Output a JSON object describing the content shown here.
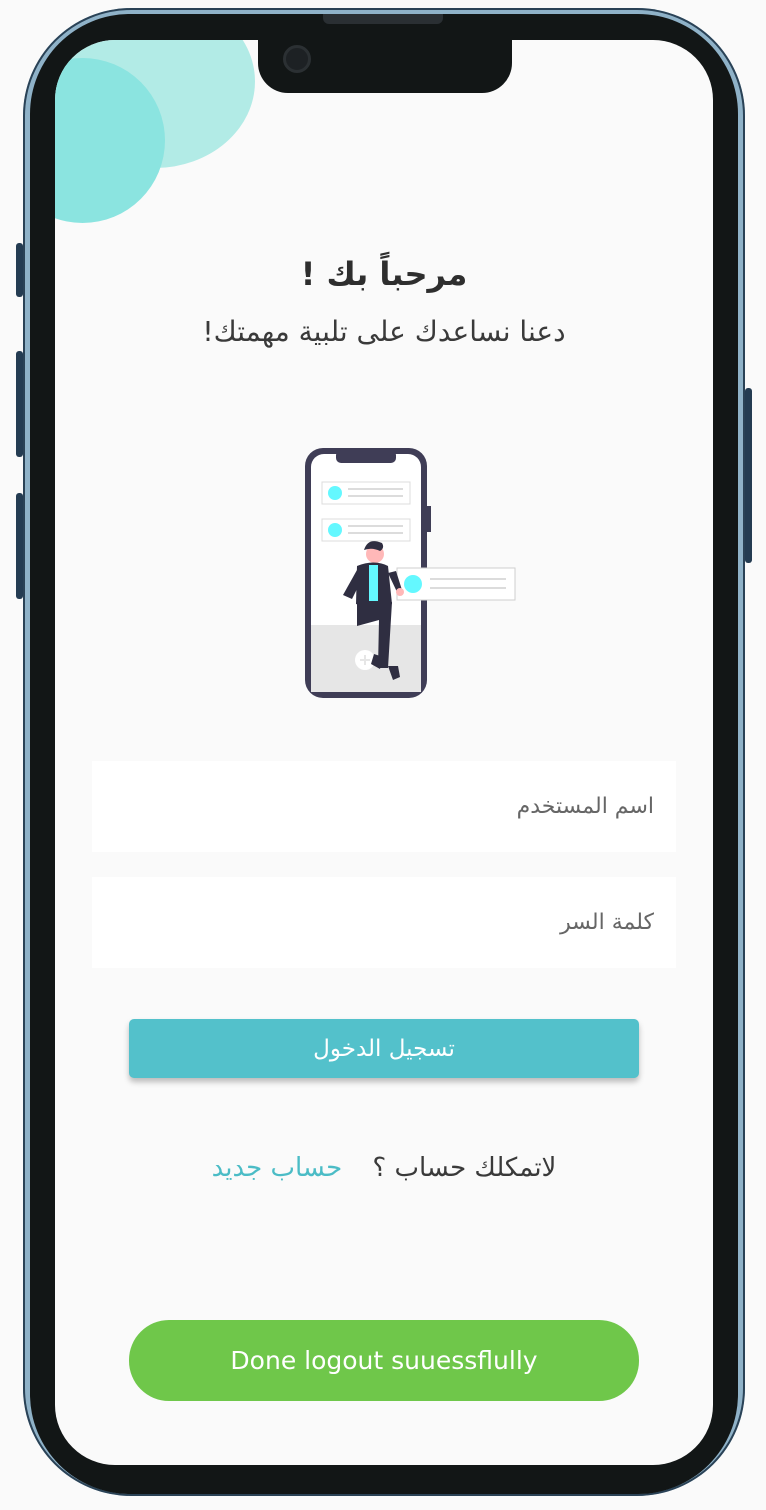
{
  "header": {
    "title": "مرحباً بك !",
    "subtitle": "دعنا نساعدك على تلبية مهمتك!"
  },
  "form": {
    "username_placeholder": "اسم المستخدم",
    "password_placeholder": "كلمة السر",
    "login_label": "تسجيل الدخول"
  },
  "signup": {
    "question": "لاتمكلك حساب ؟",
    "link": "حساب جديد"
  },
  "toast": {
    "message": "Done logout suuessflully"
  },
  "colors": {
    "accent": "#53c1cb",
    "link": "#4bbcc6",
    "toast": "#6fc74a",
    "decor_light": "#b2ebe6",
    "decor_mid": "#8be4e0"
  },
  "icons": {
    "illustration": "person-sitting-on-phone-illustration"
  }
}
